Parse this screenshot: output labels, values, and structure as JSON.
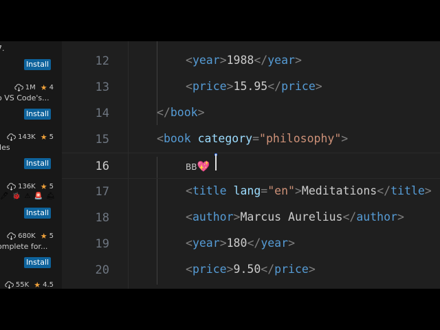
{
  "sidebar": {
    "extensions": [
      {
        "downloads": "",
        "rating": "",
        "description": "7.",
        "install_label": "Install"
      },
      {
        "downloads": "1M",
        "rating": "4",
        "description": "o VS Code's...",
        "install_label": "Install"
      },
      {
        "downloads": "143K",
        "rating": "5",
        "description": "iles",
        "install_label": "Install"
      },
      {
        "downloads": "136K",
        "rating": "5",
        "description": "",
        "badges": "🖊 🐞 ⚠ 🚨 🛎",
        "install_label": "Install"
      },
      {
        "downloads": "680K",
        "rating": "5",
        "description": "omplete for...",
        "install_label": "Install"
      },
      {
        "downloads": "55K",
        "rating": "4.5",
        "description": "",
        "install_label": ""
      }
    ]
  },
  "editor": {
    "current_line": 16,
    "lines": [
      {
        "num": "12",
        "tokens": [
          "<",
          "year",
          ">",
          "1988",
          "</",
          "year",
          ">"
        ]
      },
      {
        "num": "13",
        "tokens": [
          "<",
          "price",
          ">",
          "15.95",
          "</",
          "price",
          ">"
        ]
      },
      {
        "num": "14",
        "tokens": [
          "</",
          "book",
          ">"
        ]
      },
      {
        "num": "15",
        "tokens": [
          "<",
          "book",
          "category",
          "=",
          "\"philosophy\"",
          ">"
        ]
      },
      {
        "num": "16",
        "tokens": [
          "BB",
          "💖"
        ]
      },
      {
        "num": "17",
        "tokens": [
          "<",
          "title",
          "lang",
          "=",
          "\"en\"",
          ">",
          "Meditations",
          "</",
          "title",
          ">"
        ]
      },
      {
        "num": "18",
        "tokens": [
          "<",
          "author",
          ">",
          "Marcus Aurelius",
          "</",
          "author",
          ">"
        ]
      },
      {
        "num": "19",
        "tokens": [
          "<",
          "year",
          ">",
          "180",
          "</",
          "year",
          ">"
        ]
      },
      {
        "num": "20",
        "tokens": [
          "<",
          "price",
          ">",
          "9.50",
          "</",
          "price",
          ">"
        ]
      }
    ]
  },
  "colors": {
    "tag": "#569cd6",
    "attribute": "#9cdcfe",
    "string": "#ce9178",
    "punctuation": "#808080",
    "text": "#cccccc",
    "install_button": "#0e639c",
    "star": "#f0a23b"
  },
  "icons": {
    "download": "cloud-download-icon",
    "rating": "star-icon"
  }
}
